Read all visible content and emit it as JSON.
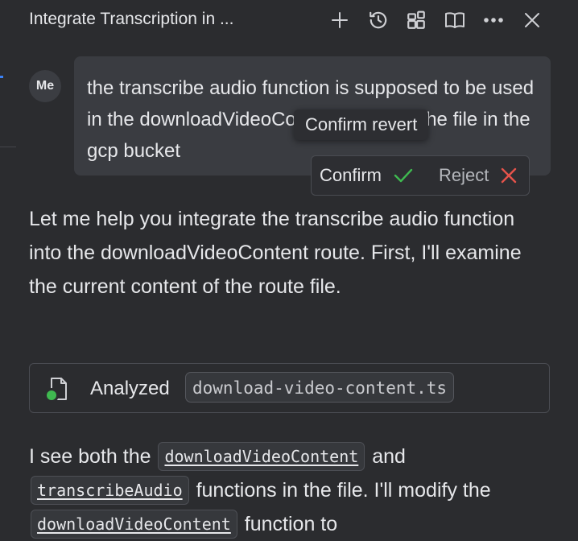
{
  "header": {
    "title": "Integrate Transcription in ...",
    "icons": [
      "plus-icon",
      "history-icon",
      "widgets-icon",
      "book-icon",
      "more-icon",
      "close-icon"
    ]
  },
  "user_message": {
    "avatar": "Me",
    "text": "the transcribe audio function is supposed to be used in the downloadVideoContent route on the file in the gcp bucket"
  },
  "revert_popup": {
    "tooltip": "Confirm revert",
    "confirm_label": "Confirm",
    "reject_label": "Reject",
    "colors": {
      "confirm": "#3fb950",
      "reject": "#e5534b"
    }
  },
  "assistant": {
    "paragraph1": "Let me help you integrate the transcribe audio function into the downloadVideoContent route. First, I'll examine the current content of the route file.",
    "tool_call": {
      "label": "Analyzed",
      "file": "download-video-content.ts",
      "status_color": "#3fb950"
    },
    "paragraph2": {
      "part1": "I see both the",
      "code1": "downloadVideoContent",
      "part2": "and",
      "code2": "transcribeAudio",
      "part3": "functions in the file. I'll modify the",
      "code3": "downloadVideoContent",
      "part4": "function to"
    }
  }
}
